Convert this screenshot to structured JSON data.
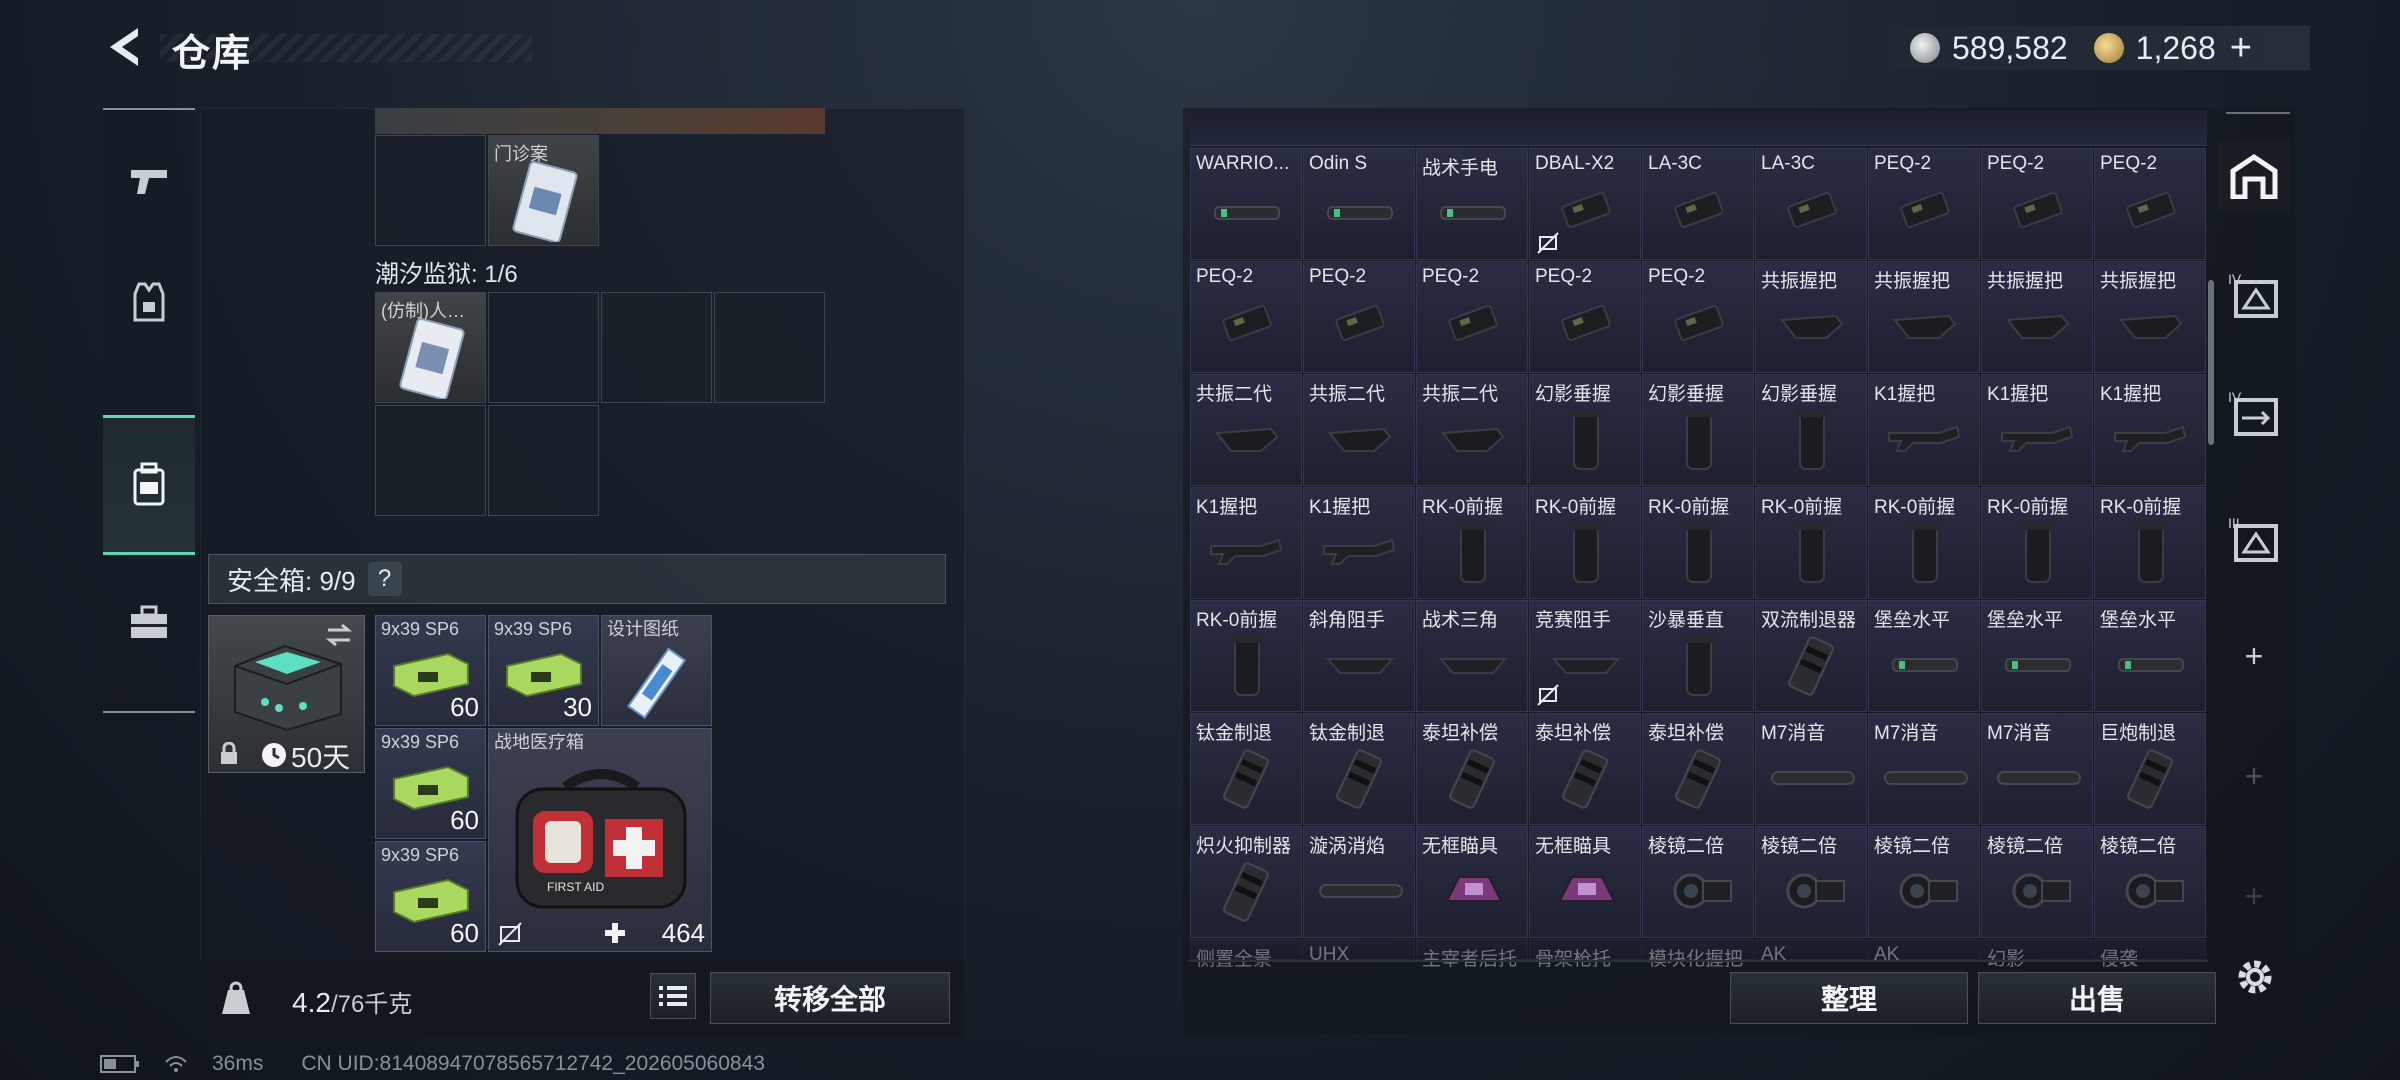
{
  "header": {
    "title": "仓库",
    "silver": "589,582",
    "gold": "1,268",
    "plus": "+"
  },
  "left": {
    "top_item_label": "门诊案",
    "prison_label": "潮汐监狱: 1/6",
    "prison_item_label": "(仿制)人…",
    "safe_label": "安全箱: 9/9",
    "help": "?",
    "safe_duration": "50天",
    "ammo": [
      {
        "label": "9x39 SP6",
        "count": "60"
      },
      {
        "label": "9x39 SP6",
        "count": "30"
      },
      {
        "label": "9x39 SP6",
        "count": "60"
      },
      {
        "label": "9x39 SP6",
        "count": "60"
      }
    ],
    "blueprint_label": "设计图纸",
    "medkit_label": "战地医疗箱",
    "medkit_durability": "464",
    "medkit_text": "FIRST AID",
    "weight_current": "4.2",
    "weight_max": "/76千克",
    "transfer_all": "转移全部"
  },
  "grid": {
    "rows": [
      [
        "WARRIO...",
        "Odin S",
        "战术手电",
        "DBAL-X2",
        "LA-3C",
        "LA-3C",
        "PEQ-2",
        "PEQ-2",
        "PEQ-2"
      ],
      [
        "PEQ-2",
        "PEQ-2",
        "PEQ-2",
        "PEQ-2",
        "PEQ-2",
        "共振握把",
        "共振握把",
        "共振握把",
        "共振握把"
      ],
      [
        "共振二代",
        "共振二代",
        "共振二代",
        "幻影垂握",
        "幻影垂握",
        "幻影垂握",
        "K1握把",
        "K1握把",
        "K1握把"
      ],
      [
        "K1握把",
        "K1握把",
        "RK-0前握",
        "RK-0前握",
        "RK-0前握",
        "RK-0前握",
        "RK-0前握",
        "RK-0前握",
        "RK-0前握"
      ],
      [
        "RK-0前握",
        "斜角阻手",
        "战术三角",
        "竞赛阻手",
        "沙暴垂直",
        "双流制退器",
        "堡垒水平",
        "堡垒水平",
        "堡垒水平"
      ],
      [
        "钛金制退",
        "钛金制退",
        "泰坦补偿",
        "泰坦补偿",
        "泰坦补偿",
        "M7消音",
        "M7消音",
        "M7消音",
        "巨炮制退"
      ],
      [
        "炽火抑制器",
        "漩涡消焰",
        "无框瞄具",
        "无框瞄具",
        "棱镜二倍",
        "棱镜二倍",
        "棱镜二倍",
        "棱镜二倍",
        "棱镜二倍"
      ],
      [
        "侧置全景",
        "UHX",
        "主宰者后托",
        "骨架枪托",
        "模块化握把",
        "AK",
        "AK",
        "幻影",
        "侵袭"
      ]
    ],
    "organize": "整理",
    "sell": "出售"
  },
  "side": {
    "items": [
      "IV",
      "IV",
      "III",
      "+",
      "+",
      "+"
    ]
  },
  "status": {
    "ping": "36ms",
    "uid": "CN UID:8140894707856571274​2_202605060843"
  }
}
